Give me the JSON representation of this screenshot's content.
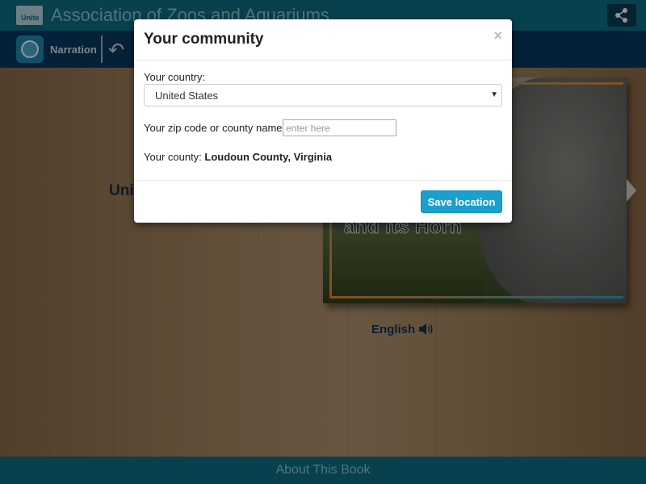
{
  "app": {
    "logo_text": "Unite",
    "title": "Association of Zoos and Aquariums"
  },
  "navbar": {
    "narration_label": "Narration"
  },
  "main": {
    "partial_title": "Unit",
    "cover_text": "and Its Horn",
    "language_label": "English"
  },
  "footer": {
    "about_label": "About This Book"
  },
  "modal": {
    "title": "Your community",
    "close_symbol": "×",
    "country_label": "Your country:",
    "country_value": "United States",
    "zip_label": "Your zip code or county name:",
    "zip_placeholder": "enter here",
    "zip_value": "",
    "county_label": "Your county:",
    "county_value": "Loudoun County, Virginia",
    "save_label": "Save location"
  },
  "colors": {
    "topbar": "#0f6f86",
    "navbar": "#0a3a60",
    "accent_button": "#1aa0cc"
  },
  "icons": [
    "share-icon",
    "globe-icon",
    "back-arrow-icon",
    "speaker-icon",
    "next-page-icon",
    "close-icon",
    "caret-down-icon"
  ]
}
